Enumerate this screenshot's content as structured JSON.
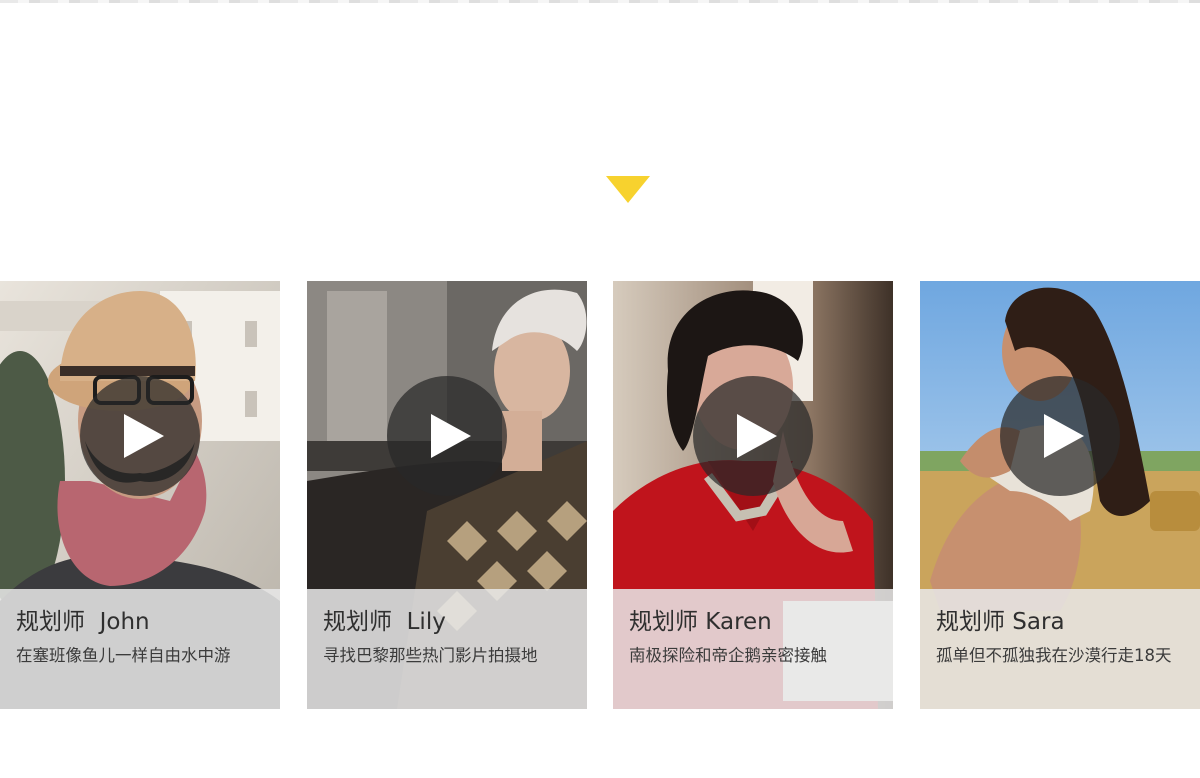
{
  "section": {
    "accent_color": "#f7d22e",
    "arrow_icon": "triangle-down-icon"
  },
  "planners": [
    {
      "title": "规划师  John",
      "description": "在塞班像鱼儿一样自由水中游",
      "play_icon": "play-icon"
    },
    {
      "title": "规划师  Lily",
      "description": "寻找巴黎那些热门影片拍摄地",
      "play_icon": "play-icon"
    },
    {
      "title": "规划师 Karen",
      "description": "南极探险和帝企鹅亲密接触",
      "play_icon": "play-icon"
    },
    {
      "title": "规划师 Sara",
      "description": "孤单但不孤独我在沙漠行走18天",
      "play_icon": "play-icon"
    }
  ]
}
